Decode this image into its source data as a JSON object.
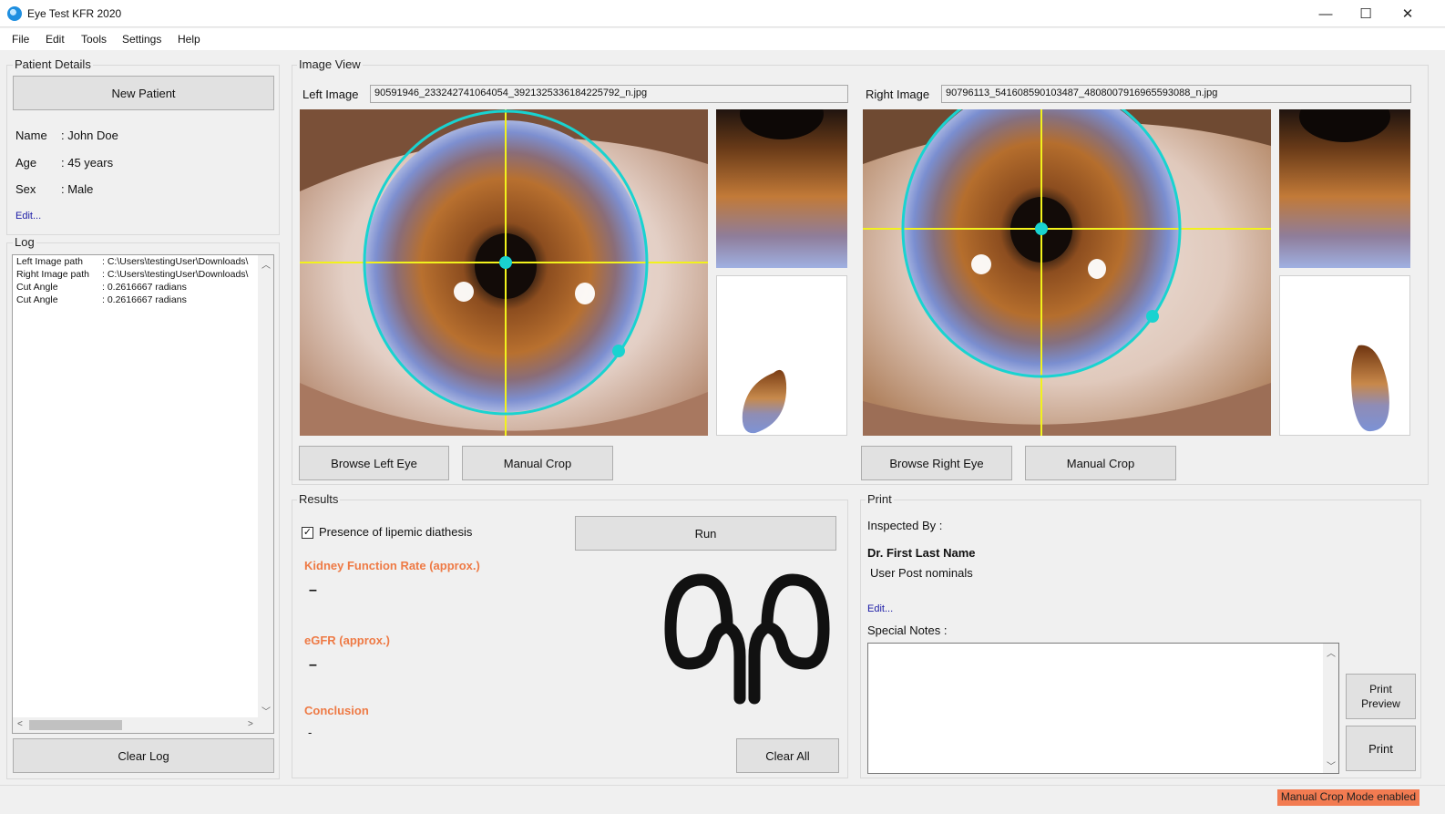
{
  "window": {
    "title": "Eye Test KFR 2020",
    "minimize": "—",
    "maximize": "☐",
    "close": "✕"
  },
  "menu": [
    "File",
    "Edit",
    "Tools",
    "Settings",
    "Help"
  ],
  "patient": {
    "group_label": "Patient Details",
    "new_patient": "New Patient",
    "name_label": "Name",
    "name_value": ": John Doe",
    "age_label": "Age",
    "age_value": ": 45 years",
    "sex_label": "Sex",
    "sex_value": ": Male",
    "edit": "Edit..."
  },
  "log": {
    "group_label": "Log",
    "lines": [
      {
        "key": "Left Image path",
        "value": ": C:\\Users\\testingUser\\Downloads\\"
      },
      {
        "key": "Right Image path",
        "value": ": C:\\Users\\testingUser\\Downloads\\"
      },
      {
        "key": "Cut Angle",
        "value": ": 0.2616667 radians"
      },
      {
        "key": "Cut Angle",
        "value": ": 0.2616667 radians"
      }
    ],
    "clear": "Clear Log"
  },
  "image_view": {
    "group_label": "Image View",
    "left_label": "Left Image",
    "left_file": "90591946_233242741064054_3921325336184225792_n.jpg",
    "right_label": "Right Image",
    "right_file": "90796113_541608590103487_4808007916965593088_n.jpg",
    "browse_left": "Browse Left Eye",
    "manual_crop_left": "Manual Crop",
    "browse_right": "Browse Right Eye",
    "manual_crop_right": "Manual Crop"
  },
  "results": {
    "group_label": "Results",
    "lipemic_label": "Presence of lipemic diathesis",
    "lipemic_checked": "✓",
    "run": "Run",
    "kfr_label": "Kidney Function Rate (approx.)",
    "kfr_value": "–",
    "egfr_label": "eGFR (approx.)",
    "egfr_value": "–",
    "conclusion_label": "Conclusion",
    "conclusion_value": "-",
    "clear_all": "Clear All"
  },
  "print": {
    "group_label": "Print",
    "inspected_by": "Inspected By :",
    "doctor": "Dr. First Last Name",
    "post_nominals": "User Post nominals",
    "edit": "Edit...",
    "special_notes": "Special Notes :",
    "notes_value": "",
    "print_preview_line1": "Print",
    "print_preview_line2": "Preview",
    "print": "Print"
  },
  "status": {
    "mode": "Manual Crop Mode enabled"
  },
  "colors": {
    "accent_orange": "#ee7a45",
    "status_badge": "#f27b51",
    "link": "#1a1aa6",
    "overlay_cyan": "#19d3d0",
    "overlay_yellow": "#f2f21c"
  }
}
